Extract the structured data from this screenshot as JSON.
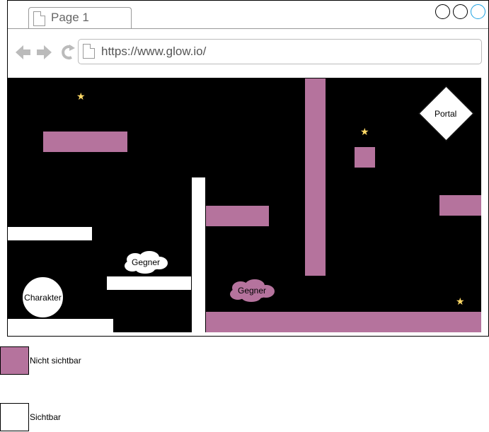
{
  "browser": {
    "tab_title": "Page 1",
    "url": "https://www.glow.io/"
  },
  "game": {
    "character_label": "Charakter",
    "enemy_label_visible": "Gegner",
    "enemy_label_hidden": "Gegner",
    "portal_label": "Portal"
  },
  "legend": {
    "hidden_label": "Nicht sichtbar",
    "visible_label": "Sichtbar"
  },
  "colors": {
    "hidden": "#b5739d",
    "visible": "#ffffff",
    "background": "#000000",
    "star": "#ffd966"
  }
}
